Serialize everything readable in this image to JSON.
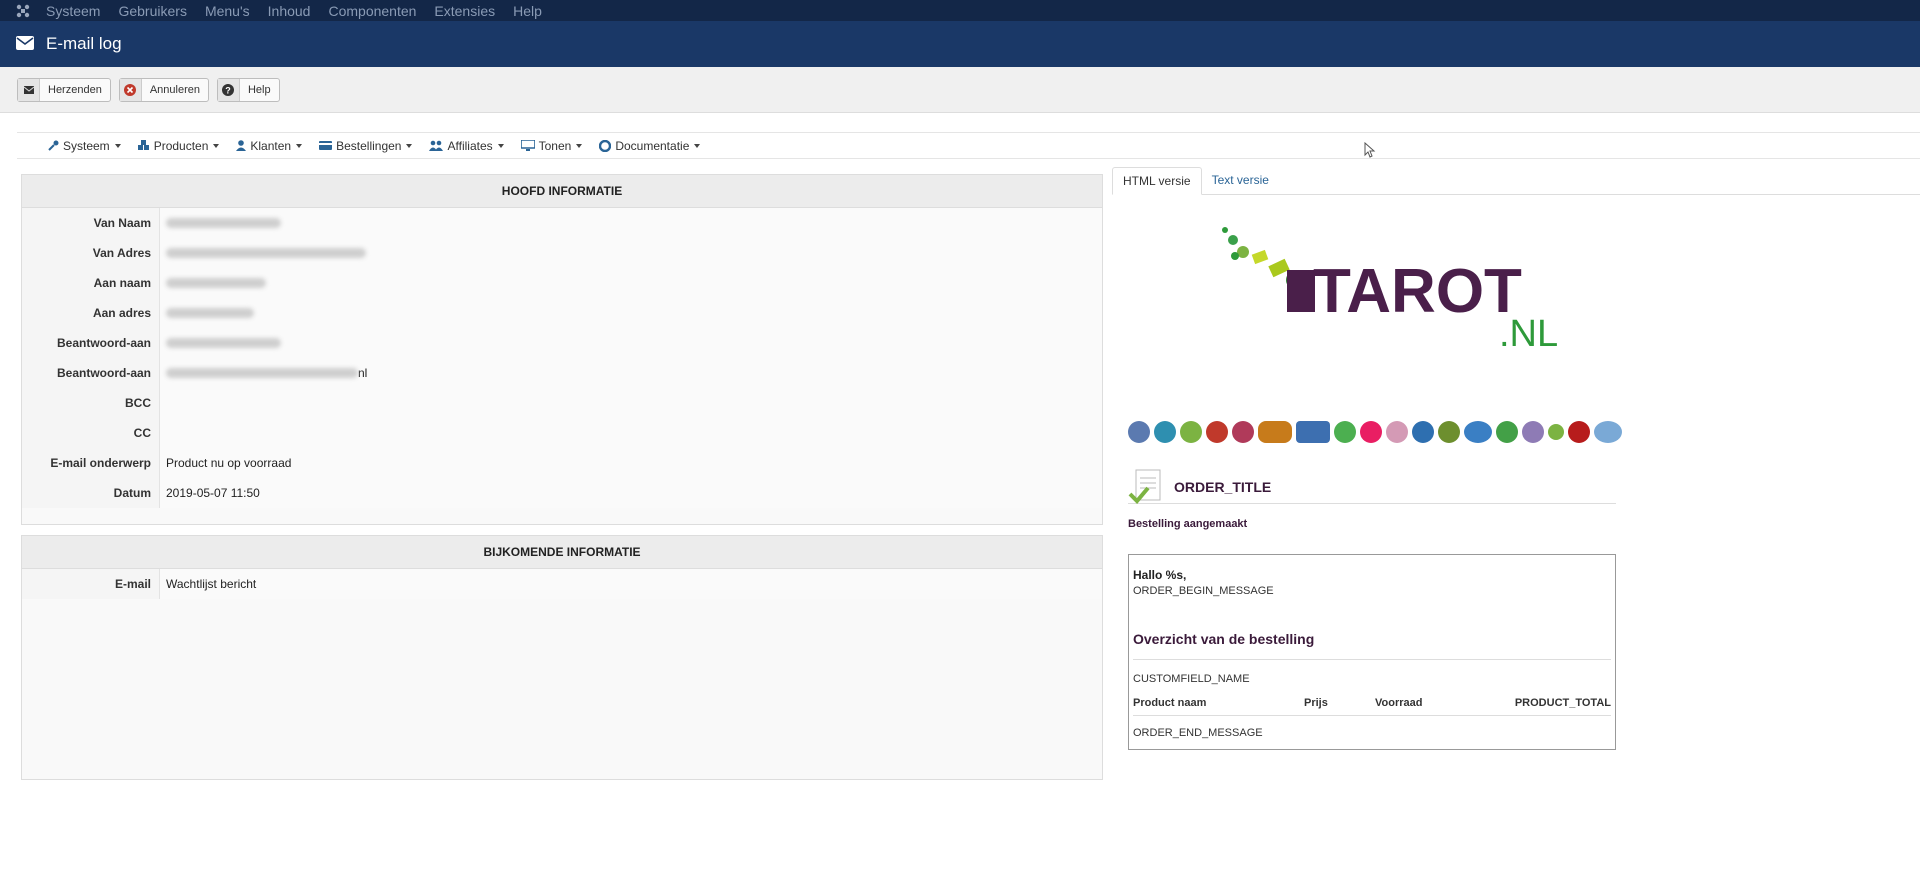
{
  "topbar": {
    "logo_icon": "joomla-icon",
    "menu": [
      "Systeem",
      "Gebruikers",
      "Menu's",
      "Inhoud",
      "Componenten",
      "Extensies",
      "Help"
    ]
  },
  "header": {
    "icon": "envelope-icon",
    "title": "E-mail log"
  },
  "toolbar": {
    "resend_label": "Herzenden",
    "cancel_label": "Annuleren",
    "help_label": "Help"
  },
  "component_nav": [
    {
      "label": "Systeem",
      "icon": "wrench-icon"
    },
    {
      "label": "Producten",
      "icon": "cubes-icon"
    },
    {
      "label": "Klanten",
      "icon": "user-icon"
    },
    {
      "label": "Bestellingen",
      "icon": "credit-card-icon"
    },
    {
      "label": "Affiliates",
      "icon": "users-icon"
    },
    {
      "label": "Tonen",
      "icon": "monitor-icon"
    },
    {
      "label": "Documentatie",
      "icon": "lifebuoy-icon"
    }
  ],
  "main_info": {
    "heading": "HOOFD INFORMATIE",
    "rows": [
      {
        "label": "Van Naam",
        "value": ""
      },
      {
        "label": "Van Adres",
        "value": ""
      },
      {
        "label": "Aan naam",
        "value": ""
      },
      {
        "label": "Aan adres",
        "value": ""
      },
      {
        "label": "Beantwoord-aan Naam",
        "value": ""
      },
      {
        "label": "Beantwoord-aan Adres",
        "value": "nl"
      },
      {
        "label": "BCC",
        "value": ""
      },
      {
        "label": "CC",
        "value": ""
      },
      {
        "label": "E-mail onderwerp",
        "value": "Product nu op voorraad"
      },
      {
        "label": "Datum",
        "value": "2019-05-07 11:50"
      }
    ]
  },
  "extra_info": {
    "heading": "BIJKOMENDE INFORMATIE",
    "rows": [
      {
        "label": "E-mail",
        "value": "Wachtlijst bericht"
      }
    ]
  },
  "tabs": {
    "html": "HTML versie",
    "text": "Text versie"
  },
  "preview": {
    "logo_text": "TAROT",
    "logo_suffix": ".NL",
    "order_title": "ORDER_TITLE",
    "order_created": "Bestelling aangemaakt",
    "greeting": "Hallo %s,",
    "begin_message": "ORDER_BEGIN_MESSAGE",
    "overview_title": "Overzicht van de bestelling",
    "customfield": "CUSTOMFIELD_NAME",
    "col_product": "Product naam",
    "col_price": "Prijs",
    "col_stock": "Voorraad",
    "col_total": "PRODUCT_TOTAL",
    "end_message": "ORDER_END_MESSAGE"
  },
  "colors": {
    "topbar": "#132748",
    "header": "#1a3867",
    "brand_purple": "#4a1f4a",
    "brand_green": "#2e9a3a"
  }
}
